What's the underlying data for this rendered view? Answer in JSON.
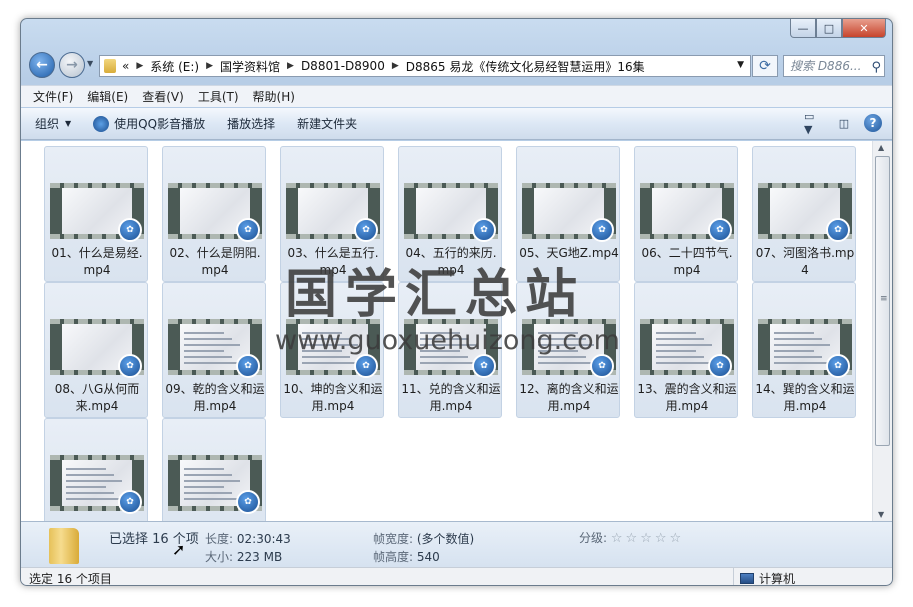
{
  "window": {
    "min": "—",
    "max": "□",
    "close": "✕"
  },
  "address": {
    "prefix": "«",
    "crumbs": [
      "系统 (E:)",
      "国学资料馆",
      "D8801-D8900",
      "D8865 易龙《传统文化易经智慧运用》16集"
    ]
  },
  "search": {
    "placeholder": "搜索 D886..."
  },
  "menu": [
    "文件(F)",
    "编辑(E)",
    "查看(V)",
    "工具(T)",
    "帮助(H)"
  ],
  "toolbar": {
    "organize": "组织",
    "play_with_qq": "使用QQ影音播放",
    "play_selection": "播放选择",
    "new_folder": "新建文件夹"
  },
  "files": [
    {
      "label": "01、什么是易经.mp4"
    },
    {
      "label": "02、什么是阴阳.mp4"
    },
    {
      "label": "03、什么是五行.mp4"
    },
    {
      "label": "04、五行的来历.mp4"
    },
    {
      "label": "05、天G地Z.mp4"
    },
    {
      "label": "06、二十四节气.mp4"
    },
    {
      "label": "07、河图洛书.mp4"
    },
    {
      "label": "08、八G从何而来.mp4"
    },
    {
      "label": "09、乾的含义和运用.mp4"
    },
    {
      "label": "10、坤的含义和运用.mp4"
    },
    {
      "label": "11、兑的含义和运用.mp4"
    },
    {
      "label": "12、离的含义和运用.mp4"
    },
    {
      "label": "13、震的含义和运用.mp4"
    },
    {
      "label": "14、巽的含义和运用.mp4"
    },
    {
      "label": ""
    },
    {
      "label": ""
    }
  ],
  "watermark": {
    "title": "国学汇总站",
    "url": "www.guoxuehuizong.com"
  },
  "details": {
    "selected": "已选择 16 个项",
    "length_key": "长度:",
    "length_val": "02:30:43",
    "size_key": "大小:",
    "size_val": "223 MB",
    "fw_key": "帧宽度:",
    "fw_val": "(多个数值)",
    "fh_key": "帧高度:",
    "fh_val": "540",
    "rating_key": "分级:",
    "rating_stars": 0
  },
  "status": {
    "left": "选定 16 个项目",
    "right": "计算机"
  }
}
